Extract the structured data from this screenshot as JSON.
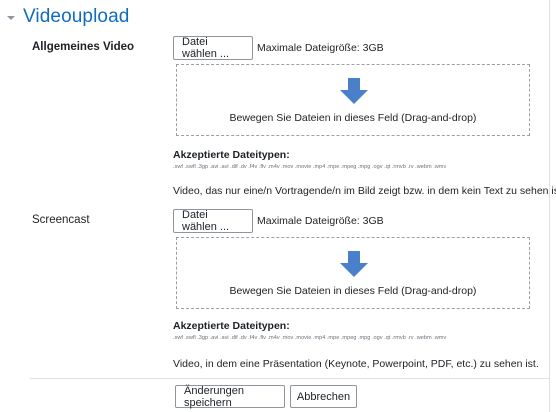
{
  "section": {
    "title": "Videoupload",
    "collapse_icon": "chevron-down-icon"
  },
  "general_video": {
    "label": "Allgemeines Video",
    "choose_button": "Datei wählen ...",
    "max_size": "Maximale Dateigröße: 3GB",
    "drop_text": "Bewegen Sie Dateien in dieses Feld (Drag-and-drop)",
    "drop_icon": "arrow-down-icon",
    "accepted_label": "Akzeptierte Dateitypen:",
    "accepted_types": ".swf .swfl .3gp .avi .avi .dif .dv .f4v .flv .m4v .mov .movie .mp4 .mpe .mpeg .mpg .ogv .qt .rmvb .rv .webm .wmv",
    "help": "Video, das nur eine/n Vortragende/n im Bild zeigt bzw. in dem kein Text zu sehen ist"
  },
  "screencast": {
    "label": "Screencast",
    "choose_button": "Datei wählen ...",
    "max_size": "Maximale Dateigröße: 3GB",
    "drop_text": "Bewegen Sie Dateien in dieses Feld (Drag-and-drop)",
    "drop_icon": "arrow-down-icon",
    "accepted_label": "Akzeptierte Dateitypen:",
    "accepted_types": ".swf .swfl .3gp .avi .avi .dif .dv .f4v .flv .m4v .mov .movie .mp4 .mpe .mpeg .mpg .ogv .qt .rmvb .rv .webm .wmv",
    "help": "Video, in dem eine Präsentation (Keynote, Powerpoint, PDF, etc.) zu sehen ist."
  },
  "actions": {
    "save": "Änderungen speichern",
    "cancel": "Abbrechen"
  },
  "colors": {
    "accent": "#0f6cbf",
    "arrow": "#4a80c9",
    "text": "#1d2125",
    "muted": "#6a737b"
  }
}
